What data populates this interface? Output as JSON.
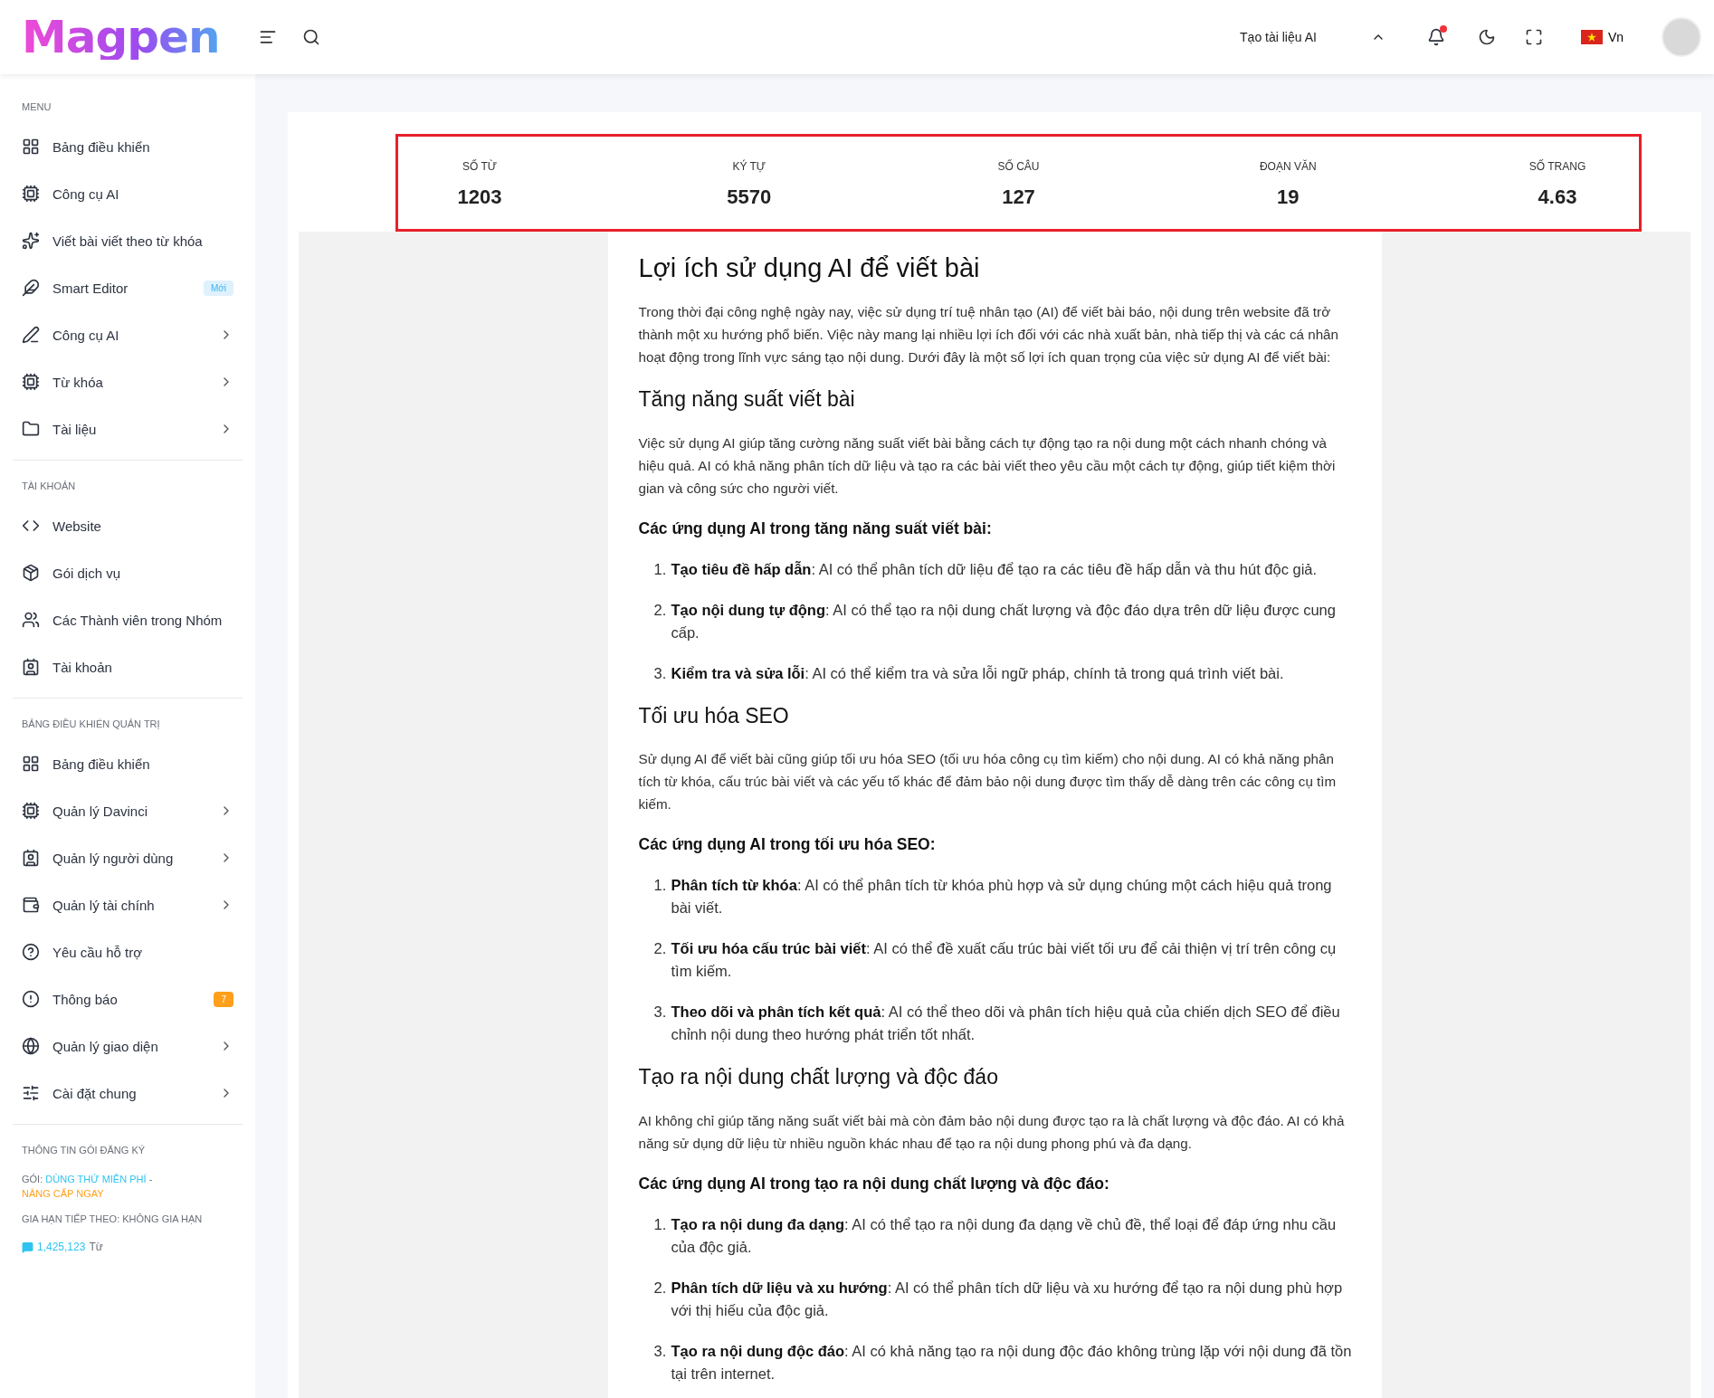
{
  "topbar": {
    "logo": "Magpen",
    "create_button": "Tạo tài liệu AI",
    "notifications_unread": true,
    "language": "Vn"
  },
  "sidebar": {
    "sections": [
      {
        "title": "MENU",
        "items": [
          {
            "label": "Bảng điều khiển",
            "submenu": false
          },
          {
            "label": "Công cụ AI",
            "submenu": false
          },
          {
            "label": "Viết bài viết theo từ khóa",
            "submenu": false
          },
          {
            "label": "Smart Editor",
            "submenu": false,
            "badge": {
              "text": "Mới",
              "kind": "new"
            }
          },
          {
            "label": "Công cụ AI",
            "submenu": true
          },
          {
            "label": "Từ khóa",
            "submenu": true
          },
          {
            "label": "Tài liệu",
            "submenu": true
          }
        ]
      },
      {
        "title": "TÀI KHOẢN",
        "items": [
          {
            "label": "Website",
            "submenu": false
          },
          {
            "label": "Gói dịch vụ",
            "submenu": false
          },
          {
            "label": "Các Thành viên trong Nhóm",
            "submenu": false
          },
          {
            "label": "Tài khoản",
            "submenu": false
          }
        ]
      },
      {
        "title": "BẢNG ĐIỀU KHIỂN QUẢN TRỊ",
        "items": [
          {
            "label": "Bảng điều khiển",
            "submenu": false
          },
          {
            "label": "Quản lý Davinci",
            "submenu": true
          },
          {
            "label": "Quản lý người dùng",
            "submenu": true
          },
          {
            "label": "Quản lý tài chính",
            "submenu": true
          },
          {
            "label": "Yêu cầu hỗ trợ",
            "submenu": false
          },
          {
            "label": "Thông báo",
            "submenu": false,
            "badge": {
              "text": "7",
              "kind": "count"
            }
          },
          {
            "label": "Quản lý giao diện",
            "submenu": true
          },
          {
            "label": "Cài đặt chung",
            "submenu": true
          }
        ]
      }
    ],
    "subscription": {
      "title": "THÔNG TIN GÓI ĐĂNG KÝ",
      "plan_label": "GÓI:",
      "plan": "DÙNG THỬ MIỄN PHÍ",
      "separator": "-",
      "upgrade_link": "NÂNG CẤP NGAY",
      "renewal": "GIA HẠN TIẾP THEO: KHÔNG GIA HẠN",
      "words": "1,425,123",
      "words_unit": "Từ"
    }
  },
  "stats": [
    {
      "label": "SỐ TỪ",
      "value": "1203"
    },
    {
      "label": "KÝ TỰ",
      "value": "5570"
    },
    {
      "label": "SỐ CÂU",
      "value": "127"
    },
    {
      "label": "ĐOẠN VĂN",
      "value": "19"
    },
    {
      "label": "SỐ TRANG",
      "value": "4.63"
    }
  ],
  "document": [
    {
      "kind": "h1",
      "text": "Lợi ích sử dụng AI để viết bài"
    },
    {
      "kind": "p",
      "text": "Trong thời đại công nghệ ngày nay, việc sử dụng trí tuệ nhân tạo (AI) để viết bài báo, nội dung trên website đã trở thành một xu hướng phổ biến. Việc này mang lại nhiều lợi ích đối với các nhà xuất bản, nhà tiếp thị và các cá nhân hoạt động trong lĩnh vực sáng tạo nội dung. Dưới đây là một số lợi ích quan trọng của việc sử dụng AI để viết bài:"
    },
    {
      "kind": "h2",
      "text": "Tăng năng suất viết bài"
    },
    {
      "kind": "p",
      "text": "Việc sử dụng AI giúp tăng cường năng suất viết bài bằng cách tự động tạo ra nội dung một cách nhanh chóng và hiệu quả. AI có khả năng phân tích dữ liệu và tạo ra các bài viết theo yêu cầu một cách tự động, giúp tiết kiệm thời gian và công sức cho người viết."
    },
    {
      "kind": "h3",
      "text": "Các ứng dụng AI trong tăng năng suất viết bài:"
    },
    {
      "kind": "ol",
      "items": [
        {
          "marker": "1.",
          "text": "**Tạo tiêu đề hấp dẫn**: AI có thể phân tích dữ liệu để tạo ra các tiêu đề hấp dẫn và thu hút độc giả."
        },
        {
          "marker": "2.",
          "text": "**Tạo nội dung tự động**: AI có thể tạo ra nội dung chất lượng và độc đáo dựa trên dữ liệu được cung cấp."
        },
        {
          "marker": "3.",
          "text": "**Kiểm tra và sửa lỗi**: AI có thể kiểm tra và sửa lỗi ngữ pháp, chính tả trong quá trình viết bài."
        }
      ]
    },
    {
      "kind": "h2",
      "text": "Tối ưu hóa SEO"
    },
    {
      "kind": "p",
      "text": "Sử dụng AI để viết bài cũng giúp tối ưu hóa SEO (tối ưu hóa công cụ tìm kiếm) cho nội dung. AI có khả năng phân tích từ khóa, cấu trúc bài viết và các yếu tố khác để đảm bảo nội dung được tìm thấy dễ dàng trên các công cụ tìm kiếm."
    },
    {
      "kind": "h3",
      "text": "Các ứng dụng AI trong tối ưu hóa SEO:"
    },
    {
      "kind": "ol",
      "items": [
        {
          "marker": "1.",
          "text": "**Phân tích từ khóa**: AI có thể phân tích từ khóa phù hợp và sử dụng chúng một cách hiệu quả trong bài viết."
        },
        {
          "marker": "2.",
          "text": "**Tối ưu hóa cấu trúc bài viết**: AI có thể đề xuất cấu trúc bài viết tối ưu để cải thiện vị trí trên công cụ tìm kiếm."
        },
        {
          "marker": "3.",
          "text": "**Theo dõi và phân tích kết quả**: AI có thể theo dõi và phân tích hiệu quả của chiến dịch SEO để điều chỉnh nội dung theo hướng phát triển tốt nhất."
        }
      ]
    },
    {
      "kind": "h2",
      "text": "Tạo ra nội dung chất lượng và độc đáo"
    },
    {
      "kind": "p",
      "text": "AI không chỉ giúp tăng năng suất viết bài mà còn đảm bảo nội dung được tạo ra là chất lượng và độc đáo. AI có khả năng sử dụng dữ liệu từ nhiều nguồn khác nhau để tạo ra nội dung phong phú và đa dạng."
    },
    {
      "kind": "h3",
      "text": "Các ứng dụng AI trong tạo ra nội dung chất lượng và độc đáo:"
    },
    {
      "kind": "ol",
      "items": [
        {
          "marker": "1.",
          "text": "**Tạo ra nội dung đa dạng**: AI có thể tạo ra nội dung đa dạng về chủ đề, thể loại để đáp ứng nhu cầu của độc giả."
        },
        {
          "marker": "2.",
          "text": "**Phân tích dữ liệu và xu hướng**: AI có thể phân tích dữ liệu và xu hướng để tạo ra nội dung phù hợp với thị hiếu của độc giả."
        },
        {
          "marker": "3.",
          "text": "**Tạo ra nội dung độc đáo**: AI có khả năng tạo ra nội dung độc đáo không trùng lặp với nội dung đã tồn tại trên internet."
        }
      ]
    }
  ]
}
